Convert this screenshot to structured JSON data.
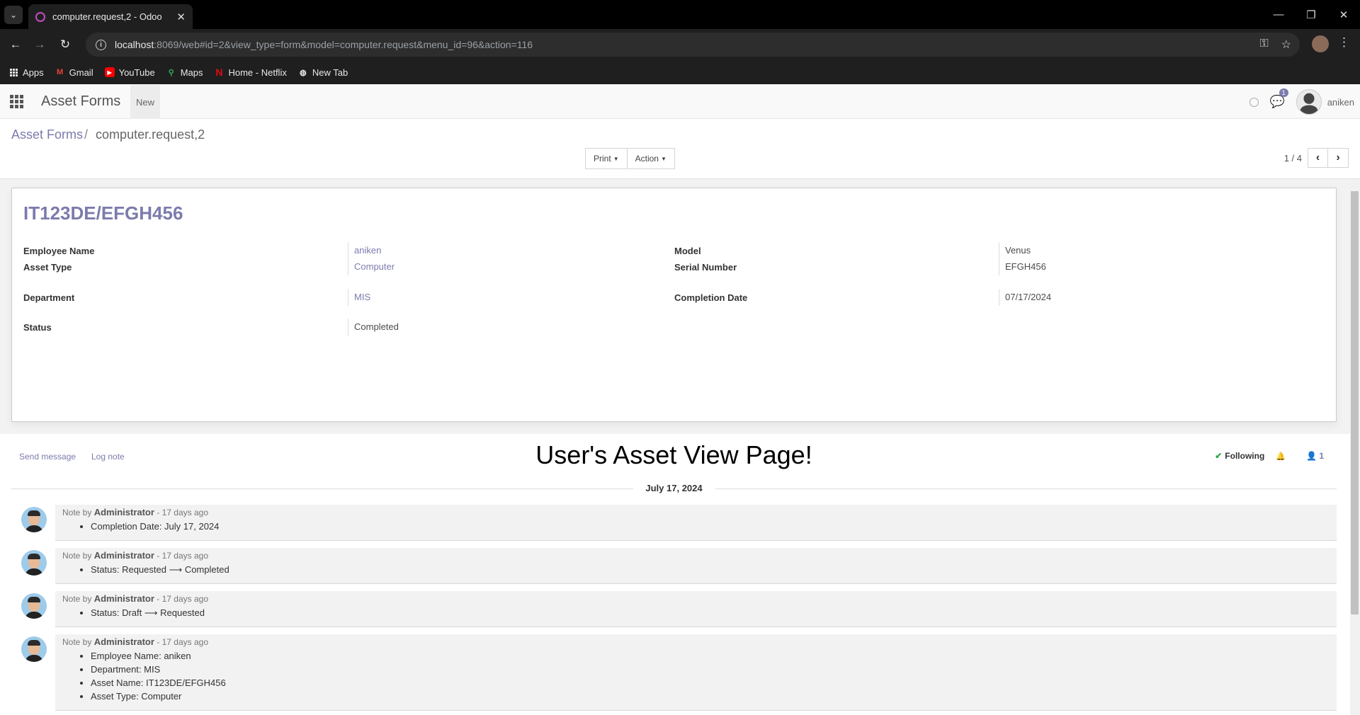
{
  "browser": {
    "tab_title": "computer.request,2 - Odoo",
    "url_host": "localhost",
    "url_rest": ":8069/web#id=2&view_type=form&model=computer.request&menu_id=96&action=116",
    "bookmarks": [
      {
        "label": "Apps",
        "icon": "apps-grid-icon"
      },
      {
        "label": "Gmail",
        "icon": "gmail-icon"
      },
      {
        "label": "YouTube",
        "icon": "youtube-icon"
      },
      {
        "label": "Maps",
        "icon": "maps-icon"
      },
      {
        "label": "Home - Netflix",
        "icon": "netflix-icon"
      },
      {
        "label": "New Tab",
        "icon": "globe-icon"
      }
    ]
  },
  "odoo": {
    "app_name": "Asset Forms",
    "menu_new": "New",
    "message_count": "1",
    "user_name": "aniken"
  },
  "control_panel": {
    "breadcrumb_parent": "Asset Forms",
    "breadcrumb_sep": "/",
    "breadcrumb_current": "computer.request,2",
    "print_label": "Print",
    "action_label": "Action",
    "pager_value": "1 / 4"
  },
  "form": {
    "title": "IT123DE/EFGH456",
    "fields": {
      "employee_name": {
        "label": "Employee Name",
        "value": "aniken"
      },
      "asset_type": {
        "label": "Asset Type",
        "value": "Computer"
      },
      "department": {
        "label": "Department",
        "value": "MIS"
      },
      "status": {
        "label": "Status",
        "value": "Completed"
      },
      "model": {
        "label": "Model",
        "value": "Venus"
      },
      "serial_number": {
        "label": "Serial Number",
        "value": "EFGH456"
      },
      "completion_date": {
        "label": "Completion Date",
        "value": "07/17/2024"
      }
    }
  },
  "chatter": {
    "send_message": "Send message",
    "log_note": "Log note",
    "heading": "User's Asset View Page!",
    "following": "Following",
    "followers_count": "1",
    "date_separator": "July 17, 2024",
    "messages": [
      {
        "prefix": "Note by",
        "author": "Administrator",
        "time": " - 17 days ago",
        "lines": [
          "Completion Date: July 17, 2024"
        ]
      },
      {
        "prefix": "Note by",
        "author": "Administrator",
        "time": " - 17 days ago",
        "lines": [
          "Status: Requested ⟶ Completed"
        ]
      },
      {
        "prefix": "Note by",
        "author": "Administrator",
        "time": " - 17 days ago",
        "lines": [
          "Status: Draft ⟶ Requested"
        ]
      },
      {
        "prefix": "Note by",
        "author": "Administrator",
        "time": " - 17 days ago",
        "lines": [
          "Employee Name: aniken",
          "Department: MIS",
          "Asset Name: IT123DE/EFGH456",
          "Asset Type: Computer"
        ]
      }
    ]
  },
  "colors": {
    "odoo_primary": "#7c7bad",
    "browser_dark": "#1f1f1f",
    "following_check": "#28a745"
  }
}
